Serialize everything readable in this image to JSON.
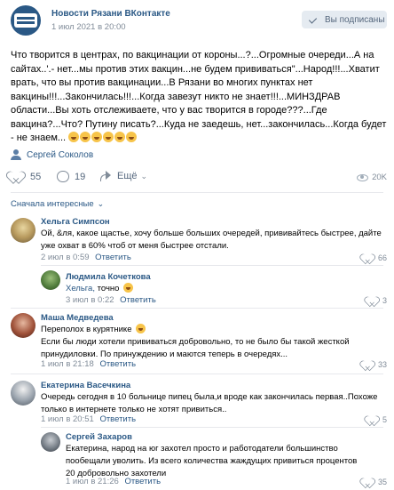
{
  "post": {
    "group_name": "Новости Рязани ВКонтакте",
    "time": "1 июл 2021 в 20:00",
    "subscribed_label": "Вы подписаны",
    "text": "Что творится в центрах, по вакцинации от короны...?...Огромные очереди...А на сайтах..'.- нет...мы против этих вакцин...не будем прививаться\"...Народ!!!...Хватит врать, что вы против вакцинации...В Рязани во многих пунктах нет вакцины!!!...Закончилась!!!...Когда завезут никто не знает!!!...МИНЗДРАВ области...Вы хоть отслеживаете, что у вас творится в городе???...Где вакцина?...Что? Путину писать?...Куда не заедешь, нет...закончилась...Когда будет - не знаем...",
    "author": "Сергей Соколов",
    "likes": "55",
    "comments": "19",
    "more_label": "Ещё",
    "views": "20K"
  },
  "comments_section": {
    "sort_label": "Сначала интересные",
    "comments": [
      {
        "name": "Хельга Симпсон",
        "text": "Ой, &ля, какое щастье, хочу больше больших очередей, прививайтесь быстрее, дайте уже охват в 60% чтоб от меня быстрее отстали.",
        "time": "2 июл в 0:59",
        "reply_label": "Ответить",
        "likes": "66"
      },
      {
        "name": "Людмила Кочеткова",
        "reply_to": "Хельга,",
        "text": "точно",
        "time": "3 июл в 0:22",
        "reply_label": "Ответить",
        "likes": "3"
      },
      {
        "name": "Маша Медведева",
        "text_line1": "Переполох в курятнике",
        "text": "Если бы люди хотели прививаться добровольно, то не было бы такой жесткой принудиловки. По принуждению и маются теперь в очередях...",
        "time": "1 июл в 21:18",
        "reply_label": "Ответить",
        "likes": "33"
      },
      {
        "name": "Екатерина Васечкина",
        "text": "Очередь сегодня в 10 больнице пипец была,и вроде как закончилась первая..Похоже только в интернете только не хотят привиться..",
        "time": "1 июл в 20:51",
        "reply_label": "Ответить",
        "likes": "5"
      },
      {
        "name": "Сергей Захаров",
        "text": "Екатерина, народ на юг захотел просто и работодатели большинство пообещали уволить. Из всего количества жаждущих привиться процентов 20 добровольно захотели",
        "time": "1 июл в 21:26",
        "reply_label": "Ответить",
        "likes": "35"
      }
    ]
  },
  "colors": {
    "link": "#2a5885",
    "meta": "#818c99",
    "button_bg": "#e5ebf1"
  }
}
